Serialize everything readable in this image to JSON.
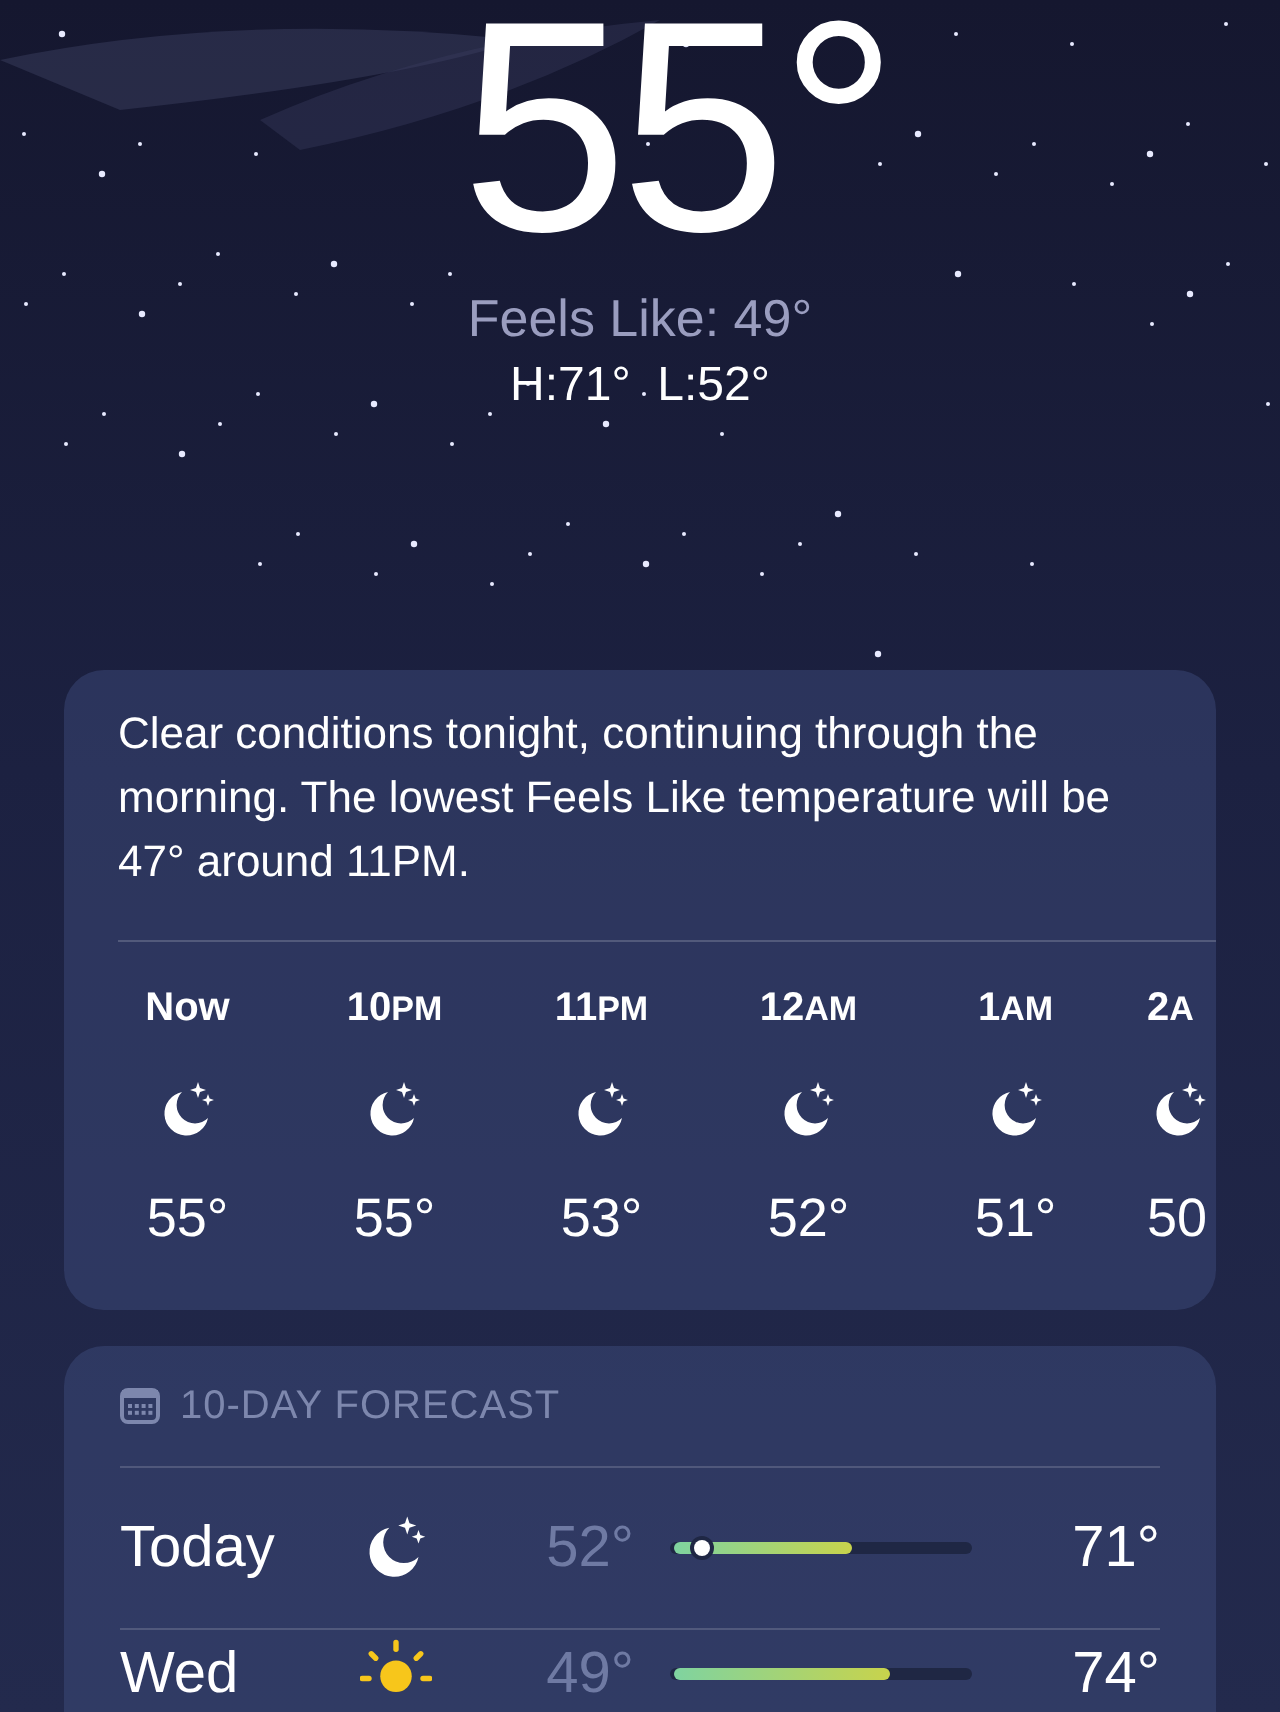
{
  "current": {
    "temperature": "55°",
    "feels_like": "Feels Like: 49°",
    "high_low": "H:71°  L:52°"
  },
  "hourly": {
    "summary": "Clear conditions tonight, continuing through the morning. The lowest Feels Like temperature will be 47° around 11PM.",
    "hours": [
      {
        "hour": "Now",
        "kind": "moon",
        "temp": "55°"
      },
      {
        "hour": "10",
        "suffix": "PM",
        "kind": "moon",
        "temp": "55°"
      },
      {
        "hour": "11",
        "suffix": "PM",
        "kind": "moon",
        "temp": "53°"
      },
      {
        "hour": "12",
        "suffix": "AM",
        "kind": "moon",
        "temp": "52°"
      },
      {
        "hour": "1",
        "suffix": "AM",
        "kind": "moon",
        "temp": "51°"
      },
      {
        "hour": "2",
        "suffix": "A",
        "kind": "moon",
        "temp": "50"
      }
    ]
  },
  "forecast": {
    "title": "10-DAY FORECAST",
    "days": [
      {
        "day": "Today",
        "kind": "moon",
        "low": "52°",
        "high": "71°",
        "level": 0.6,
        "current_marker": true
      },
      {
        "day": "Wed",
        "kind": "sun",
        "low": "49°",
        "high": "74°",
        "level": 0.73,
        "current_marker": false
      }
    ]
  }
}
